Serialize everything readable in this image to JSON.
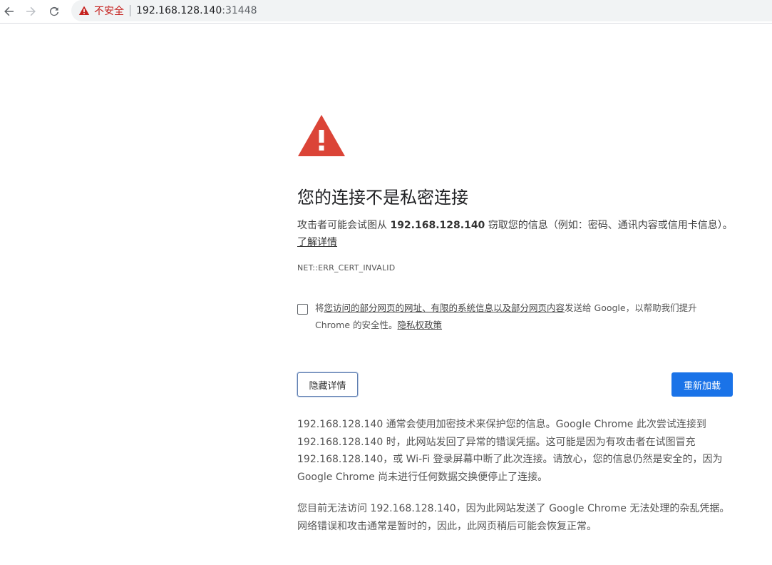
{
  "toolbar": {
    "back_icon": "back-arrow-icon",
    "forward_icon": "forward-arrow-icon",
    "reload_icon": "reload-icon",
    "security_label": "不安全",
    "url_host": "192.168.128.140",
    "url_port": ":31448"
  },
  "interstitial": {
    "heading": "您的连接不是私密连接",
    "message_prefix": "攻击者可能会试图从 ",
    "message_host": "192.168.128.140",
    "message_suffix": " 窃取您的信息（例如：密码、通讯内容或信用卡信息）。",
    "learn_more": "了解详情",
    "error_code": "NET::ERR_CERT_INVALID",
    "optin_prefix": "将",
    "optin_link": "您访问的部分网页的网址、有限的系统信息以及部分网页内容",
    "optin_middle": "发送给 Google，以帮助我们提升 Chrome 的安全性。",
    "privacy_link": "隐私权政策",
    "hide_details_button": "隐藏详情",
    "reload_button": "重新加载",
    "details_paragraph_1": "192.168.128.140 通常会使用加密技术来保护您的信息。Google Chrome 此次尝试连接到 192.168.128.140 时，此网站发回了异常的错误凭据。这可能是因为有攻击者在试图冒充 192.168.128.140，或 Wi-Fi 登录屏幕中断了此次连接。请放心，您的信息仍然是安全的，因为 Google Chrome 尚未进行任何数据交换便停止了连接。",
    "details_paragraph_2": "您目前无法访问 192.168.128.140，因为此网站发送了 Google Chrome 无法处理的杂乱凭据。网络错误和攻击通常是暂时的，因此，此网页稍后可能会恢复正常。"
  },
  "colors": {
    "warning_red": "#db4437",
    "security_text_red": "#c5221f",
    "primary_button_blue": "#1a73e8"
  }
}
